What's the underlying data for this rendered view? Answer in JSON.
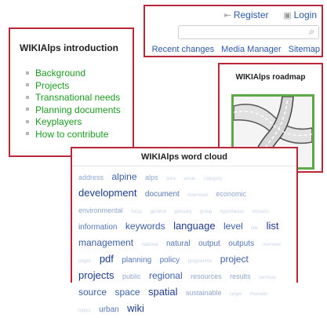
{
  "intro": {
    "title": "WIKIAlps introduction",
    "links": [
      "Background",
      "Projects",
      "Transnational needs",
      "Planning documents",
      "Keyplayers",
      "How to contribute"
    ]
  },
  "topbar": {
    "register": "Register",
    "login": "Login",
    "search_placeholder": "",
    "nav": [
      "Recent changes",
      "Media Manager",
      "Sitemap"
    ]
  },
  "roadmap": {
    "title": "WIKIAlps roadmap"
  },
  "cloud": {
    "title": "WIKIAlps word cloud",
    "words": [
      {
        "text": "address",
        "w": 2
      },
      {
        "text": "alpine",
        "w": 4
      },
      {
        "text": "alps",
        "w": 2
      },
      {
        "text": "area",
        "w": 1
      },
      {
        "text": "areas",
        "w": 1
      },
      {
        "text": "category",
        "w": 1
      },
      {
        "text": "development",
        "w": 5
      },
      {
        "text": "document",
        "w": 3
      },
      {
        "text": "download",
        "w": 1
      },
      {
        "text": "economic",
        "w": 2
      },
      {
        "text": "environmental",
        "w": 2
      },
      {
        "text": "focus",
        "w": 1
      },
      {
        "text": "general",
        "w": 1
      },
      {
        "text": "glossary",
        "w": 1
      },
      {
        "text": "group",
        "w": 1
      },
      {
        "text": "hypotheses",
        "w": 1
      },
      {
        "text": "impacts",
        "w": 1
      },
      {
        "text": "information",
        "w": 3
      },
      {
        "text": "keywords",
        "w": 4
      },
      {
        "text": "language",
        "w": 5
      },
      {
        "text": "level",
        "w": 4
      },
      {
        "text": "link",
        "w": 1
      },
      {
        "text": "list",
        "w": 5
      },
      {
        "text": "management",
        "w": 4
      },
      {
        "text": "national",
        "w": 1
      },
      {
        "text": "natural",
        "w": 3
      },
      {
        "text": "output",
        "w": 3
      },
      {
        "text": "outputs",
        "w": 3
      },
      {
        "text": "overview",
        "w": 1
      },
      {
        "text": "pages",
        "w": 1
      },
      {
        "text": "pdf",
        "w": 5
      },
      {
        "text": "planning",
        "w": 3
      },
      {
        "text": "policy",
        "w": 3
      },
      {
        "text": "programme",
        "w": 1
      },
      {
        "text": "project",
        "w": 4
      },
      {
        "text": "projects",
        "w": 5
      },
      {
        "text": "public",
        "w": 2
      },
      {
        "text": "regional",
        "w": 4
      },
      {
        "text": "resources",
        "w": 2
      },
      {
        "text": "results",
        "w": 2
      },
      {
        "text": "services",
        "w": 1
      },
      {
        "text": "source",
        "w": 4
      },
      {
        "text": "space",
        "w": 4
      },
      {
        "text": "spatial",
        "w": 5
      },
      {
        "text": "sustainable",
        "w": 2
      },
      {
        "text": "target",
        "w": 1
      },
      {
        "text": "thematic",
        "w": 1
      },
      {
        "text": "topics",
        "w": 1
      },
      {
        "text": "urban",
        "w": 3
      },
      {
        "text": "wiki",
        "w": 5
      }
    ]
  },
  "colors": {
    "accent_border": "#b8283a",
    "intro_link": "#1d9b22",
    "nav_link": "#2b5aa6",
    "roadmap_green": "#5fa84a"
  }
}
